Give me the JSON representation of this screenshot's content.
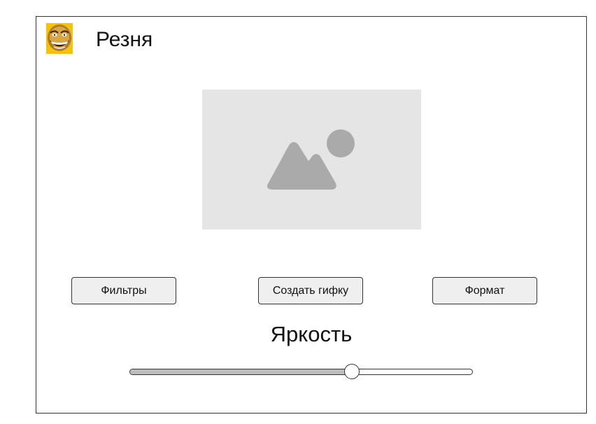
{
  "app": {
    "title": "Резня",
    "icon": "troll-face-icon"
  },
  "preview": {
    "icon": "image-placeholder-icon"
  },
  "buttons": {
    "filters": "Фильтры",
    "create_gif": "Создать гифку",
    "format": "Формат"
  },
  "brightness": {
    "label": "Яркость",
    "value": 0.65
  },
  "colors": {
    "placeholder_bg": "#e5e5e5",
    "placeholder_shape": "#aaaaaa",
    "button_bg": "#efefef",
    "border": "#333333",
    "slider_fill": "#bdbdbd"
  }
}
